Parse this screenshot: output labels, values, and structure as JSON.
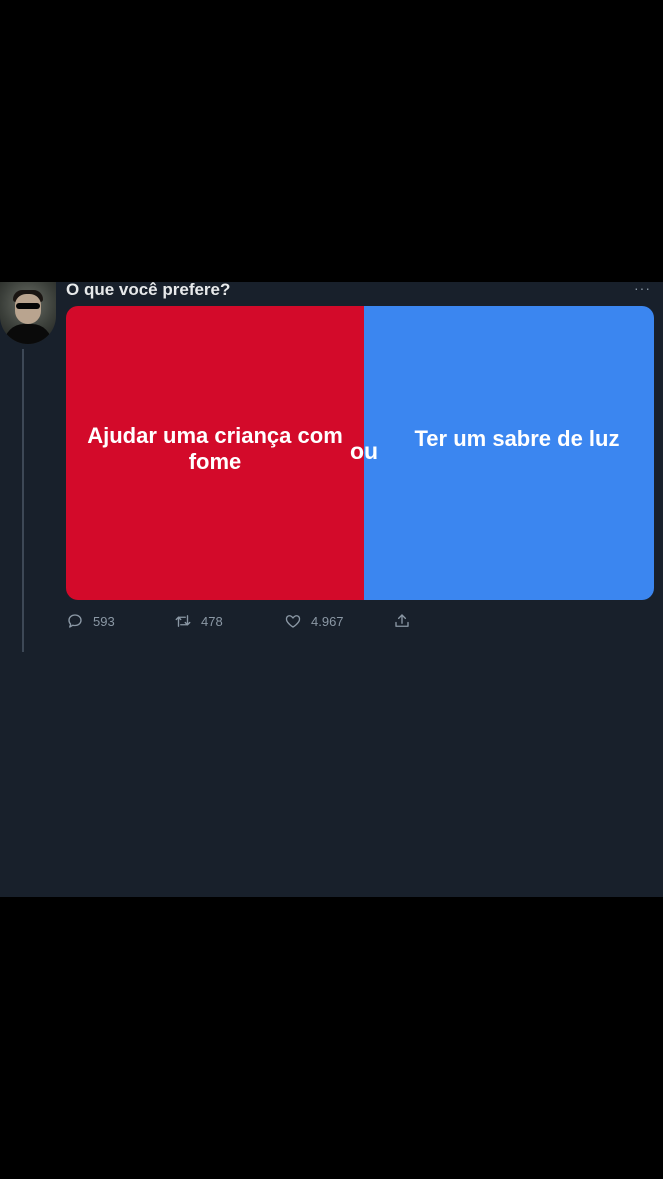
{
  "tweet": {
    "text": "O que você prefere?",
    "more_label": "···",
    "options": {
      "left": "Ajudar uma criança com fome",
      "or": "ou",
      "right": "Ter um sabre de luz"
    },
    "colors": {
      "left_option": "#d30a2a",
      "right_option": "#3b86f0",
      "panel_background": "#18202b"
    },
    "actions": {
      "replies": "593",
      "retweets": "478",
      "likes": "4.967"
    },
    "icons": [
      "reply-icon",
      "retweet-icon",
      "like-icon",
      "share-icon",
      "more-icon"
    ]
  }
}
